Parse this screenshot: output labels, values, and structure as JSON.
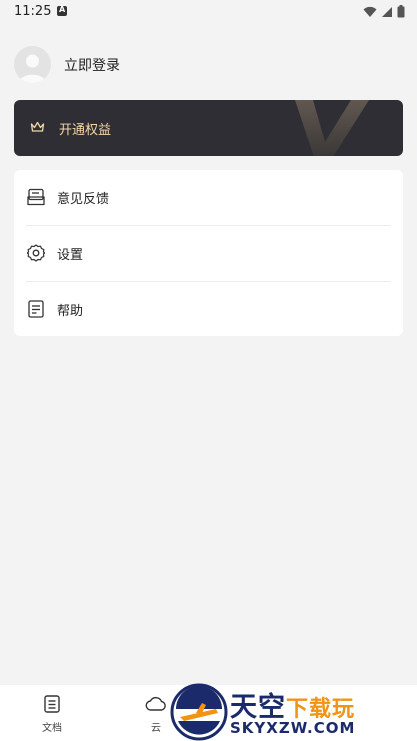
{
  "status_bar": {
    "time": "11:25"
  },
  "profile": {
    "login_label": "立即登录"
  },
  "vip": {
    "label": "开通权益"
  },
  "menu": {
    "items": [
      {
        "label": "意见反馈",
        "icon": "feedback-icon"
      },
      {
        "label": "设置",
        "icon": "gear-icon"
      },
      {
        "label": "帮助",
        "icon": "help-doc-icon"
      }
    ]
  },
  "bottom_nav": {
    "tabs": [
      {
        "label": "文档",
        "icon": "document-icon"
      },
      {
        "label": "云",
        "icon": "cloud-icon"
      }
    ]
  },
  "watermark": {
    "title_main": "天空",
    "title_accent": "下载玩",
    "subtitle": "SKYXZW.COM"
  },
  "colors": {
    "vip_bg": "#2f2e34",
    "vip_text": "#f3d7a8",
    "page_bg": "#f3f3f3"
  }
}
